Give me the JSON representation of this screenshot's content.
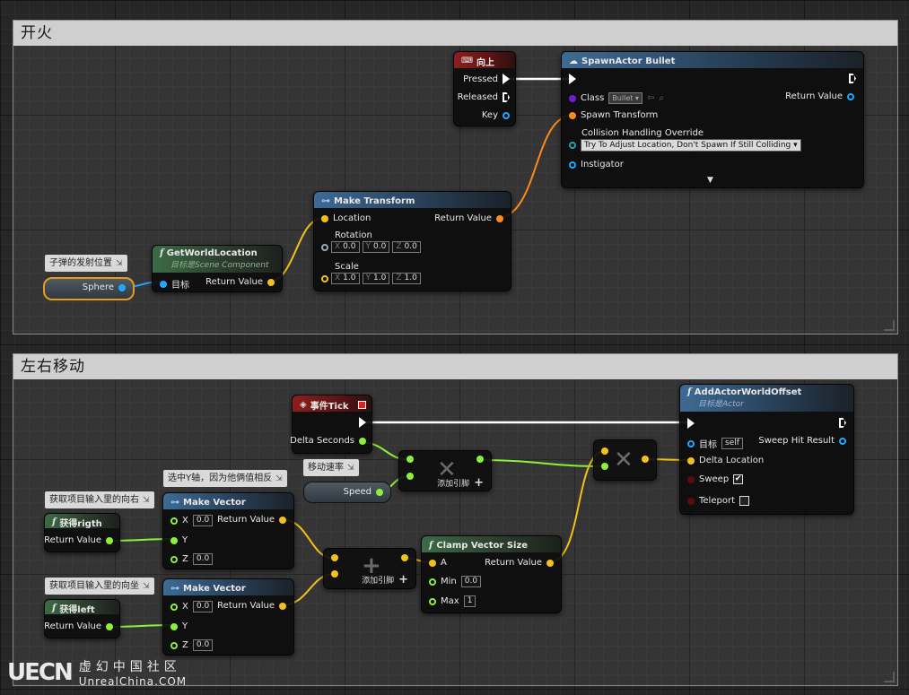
{
  "comments": {
    "fire": "开火",
    "move": "左右移动"
  },
  "nodes": {
    "input_up": {
      "title": "向上",
      "pressed": "Pressed",
      "released": "Released",
      "key": "Key"
    },
    "spawn_actor": {
      "title": "SpawnActor Bullet",
      "class_label": "Class",
      "class_value": "Bullet",
      "return_value": "Return Value",
      "spawn_transform": "Spawn Transform",
      "collision_label": "Collision Handling Override",
      "collision_value": "Try To Adjust Location, Don't Spawn If Still Colliding",
      "instigator": "Instigator"
    },
    "make_transform": {
      "title": "Make Transform",
      "location": "Location",
      "return_value": "Return Value",
      "rotation": "Rotation",
      "rot_x": "0.0",
      "rot_y": "0.0",
      "rot_z": "0.0",
      "scale": "Scale",
      "scale_x": "1.0",
      "scale_y": "1.0",
      "scale_z": "1.0"
    },
    "get_world_location": {
      "title": "GetWorldLocation",
      "subtitle": "目标是Scene Component",
      "target": "目标",
      "return_value": "Return Value"
    },
    "sphere": {
      "label": "Sphere",
      "comment": "子弹的发射位置"
    },
    "event_tick": {
      "title": "事件Tick",
      "delta": "Delta Seconds"
    },
    "speed": {
      "label": "Speed",
      "comment": "移动速率"
    },
    "multiply_top": {
      "add_pin": "添加引脚"
    },
    "multiply_right": {},
    "add_node": {
      "add_pin": "添加引脚"
    },
    "get_right": {
      "title": "获得rigth",
      "return_value": "Return Value",
      "comment": "获取项目输入里的向右"
    },
    "get_left": {
      "title": "获得left",
      "return_value": "Return Value",
      "comment": "获取项目输入里的向坐"
    },
    "make_vector_1": {
      "title": "Make Vector",
      "comment": "选中Y轴，因为他俩值相反",
      "x": "X",
      "x_val": "0.0",
      "y": "Y",
      "z": "Z",
      "z_val": "0.0",
      "return_value": "Return Value"
    },
    "make_vector_2": {
      "title": "Make Vector",
      "x": "X",
      "x_val": "0.0",
      "y": "Y",
      "z": "Z",
      "z_val": "0.0",
      "return_value": "Return Value"
    },
    "clamp": {
      "title": "Clamp Vector Size",
      "a": "A",
      "min": "Min",
      "min_val": "0.0",
      "max": "Max",
      "max_val": "1",
      "return_value": "Return Value"
    },
    "add_offset": {
      "title": "AddActorWorldOffset",
      "subtitle": "目标是Actor",
      "target": "目标",
      "self": "self",
      "sweep_hit": "Sweep Hit Result",
      "delta": "Delta Location",
      "sweep": "Sweep",
      "teleport": "Teleport"
    }
  },
  "watermark": {
    "mark": "UECN",
    "cn": "虚幻中国社区",
    "en": "UnrealChina.COM"
  },
  "colors": {
    "exec": "#ffffff",
    "vector": "#f2c21b",
    "float": "#8cf03a",
    "object": "#20a7ff",
    "transform": "#ff8a1c"
  }
}
